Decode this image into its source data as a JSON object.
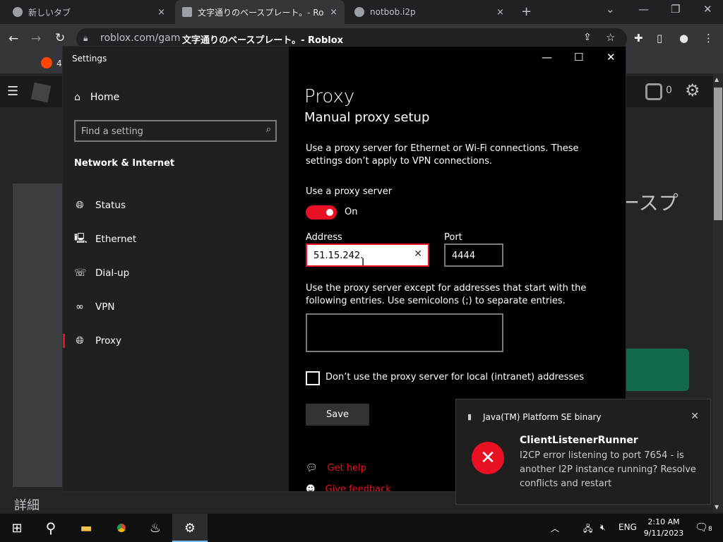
{
  "browser": {
    "tabs": [
      {
        "title": "新しいタブ",
        "close": "×"
      },
      {
        "title": "文字通りのベースプレート。- Roblox",
        "close": "×"
      },
      {
        "title": "notbob.i2p",
        "close": "×"
      }
    ],
    "new_tab": "+",
    "url": "roblox.com/gam",
    "page_title_overlay": "文字通りのベースプレート。- Roblox",
    "bookmark_count": "4"
  },
  "roblox": {
    "robux": "0",
    "partial_title": "ースプ",
    "more_label": "詳細"
  },
  "settings": {
    "window_title": "Settings",
    "home_label": "Home",
    "search_placeholder": "Find a setting",
    "section_label": "Network & Internet",
    "nav_items": [
      {
        "label": "Status",
        "icon": "globe-icon"
      },
      {
        "label": "Ethernet",
        "icon": "ethernet-icon"
      },
      {
        "label": "Dial-up",
        "icon": "dialup-icon"
      },
      {
        "label": "VPN",
        "icon": "vpn-icon"
      },
      {
        "label": "Proxy",
        "icon": "globe-icon"
      }
    ],
    "page_title": "Proxy",
    "section_title": "Manual proxy setup",
    "description": "Use a proxy server for Ethernet or Wi-Fi connections. These settings don’t apply to VPN connections.",
    "use_proxy_label": "Use a proxy server",
    "toggle_state": "On",
    "address_label": "Address",
    "address_value": "51.15.242.",
    "port_label": "Port",
    "port_value": "4444",
    "exceptions_description": "Use the proxy server except for addresses that start with the following entries. Use semicolons (;) to separate entries.",
    "exceptions_value": "",
    "local_checkbox_label": "Don’t use the proxy server for local (intranet) addresses",
    "save_label": "Save",
    "get_help": "Get help",
    "give_feedback": "Give feedback"
  },
  "toast": {
    "app_name": "Java(TM) Platform SE binary",
    "title": "ClientListenerRunner",
    "message": "I2CP error listening to port 7654 - is another I2P instance running? Resolve conflicts and restart"
  },
  "taskbar": {
    "language": "ENG",
    "time": "2:10 AM",
    "date": "9/11/2023",
    "notification_count": "8"
  },
  "colors": {
    "accent": "#e81123",
    "settings_nav_bg": "#202020",
    "content_bg": "#000000"
  }
}
